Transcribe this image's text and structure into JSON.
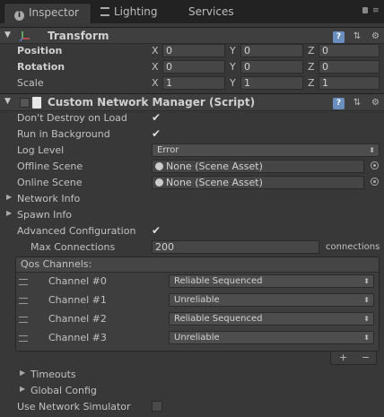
{
  "tabs": [
    {
      "label": "Inspector",
      "icon": "info-icon",
      "active": true
    },
    {
      "label": "Lighting",
      "icon": "lighting-icon",
      "active": false
    },
    {
      "label": "Services",
      "icon": "",
      "active": false
    }
  ],
  "transform": {
    "title": "Transform",
    "position": {
      "label": "Position",
      "x": "0",
      "y": "0",
      "z": "0"
    },
    "rotation": {
      "label": "Rotation",
      "x": "0",
      "y": "0",
      "z": "0"
    },
    "scale": {
      "label": "Scale",
      "x": "1",
      "y": "1",
      "z": "1"
    },
    "axis_labels": {
      "x": "X",
      "y": "Y",
      "z": "Z"
    }
  },
  "network_manager": {
    "title": "Custom Network Manager (Script)",
    "dont_destroy": {
      "label": "Don't Destroy on Load",
      "checked": true
    },
    "run_in_background": {
      "label": "Run in Background",
      "checked": true
    },
    "log_level": {
      "label": "Log Level",
      "value": "Error"
    },
    "offline_scene": {
      "label": "Offline Scene",
      "value": "None (Scene Asset)"
    },
    "online_scene": {
      "label": "Online Scene",
      "value": "None (Scene Asset)"
    },
    "network_info": {
      "label": "Network Info"
    },
    "spawn_info": {
      "label": "Spawn Info"
    },
    "advanced_configuration": {
      "label": "Advanced Configuration",
      "checked": true
    },
    "max_connections": {
      "label": "Max Connections",
      "value": "200",
      "unit": "connections"
    },
    "qos": {
      "title": "Qos Channels:",
      "channels": [
        {
          "label": "Channel #0",
          "value": "Reliable Sequenced"
        },
        {
          "label": "Channel #1",
          "value": "Unreliable"
        },
        {
          "label": "Channel #2",
          "value": "Reliable Sequenced"
        },
        {
          "label": "Channel #3",
          "value": "Unreliable"
        }
      ],
      "add_label": "+",
      "remove_label": "−"
    },
    "timeouts": {
      "label": "Timeouts"
    },
    "global_config": {
      "label": "Global Config"
    },
    "use_network_simulator": {
      "label": "Use Network Simulator",
      "checked": false
    }
  },
  "glyphs": {
    "check": "✔",
    "fold_open": "▼",
    "fold_closed": "▶",
    "dropdown_arrow": "⬍",
    "help": "?",
    "settings": "⚙",
    "presets": "⇅"
  }
}
